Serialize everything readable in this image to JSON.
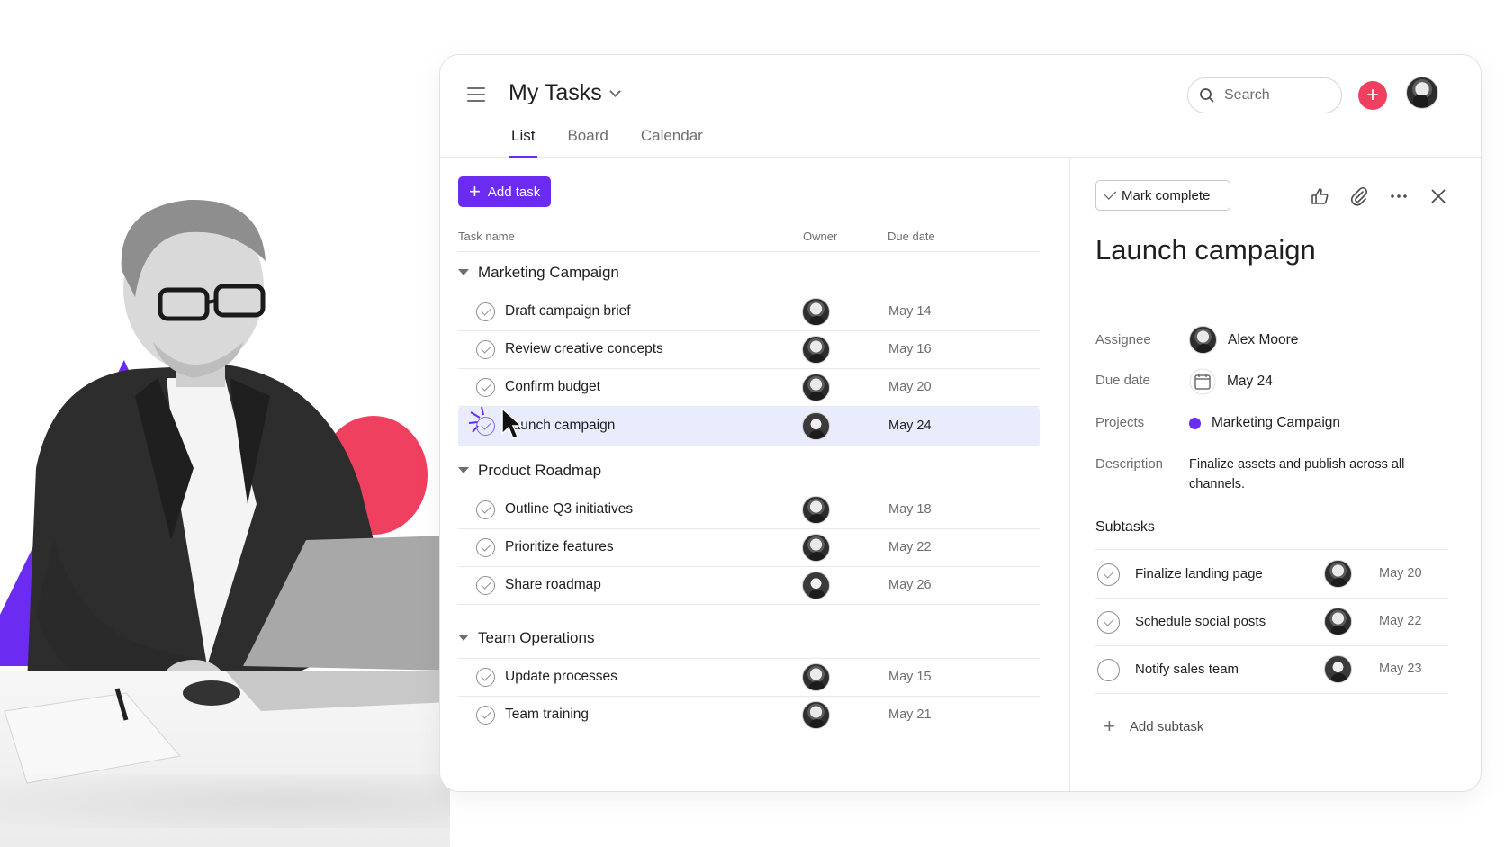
{
  "header": {
    "title": "My Tasks",
    "tabs": [
      "List",
      "Board",
      "Calendar"
    ],
    "search_placeholder": "Search",
    "add_symbol": "+"
  },
  "list": {
    "add_task_label": "Add task",
    "columns": {
      "name": "Task name",
      "owner": "Owner",
      "due": "Due date"
    },
    "sections": [
      {
        "title": "Marketing Campaign",
        "tasks": [
          {
            "name": "Draft campaign brief",
            "due": "May 14"
          },
          {
            "name": "Review creative concepts",
            "due": "May 16"
          },
          {
            "name": "Confirm budget",
            "due": "May 20"
          },
          {
            "name": "Launch campaign",
            "due": "May 24"
          }
        ]
      },
      {
        "title": "Product Roadmap",
        "tasks": [
          {
            "name": "Outline Q3 initiatives",
            "due": "May 18"
          },
          {
            "name": "Prioritize features",
            "due": "May 22"
          },
          {
            "name": "Share roadmap",
            "due": "May 26"
          }
        ]
      },
      {
        "title": "Team Operations",
        "tasks": [
          {
            "name": "Update processes",
            "due": "May 15"
          },
          {
            "name": "Team training",
            "due": "May 21"
          }
        ]
      }
    ]
  },
  "detail": {
    "mark_complete_label": "Mark complete",
    "title": "Launch campaign",
    "assignee_label": "Assignee",
    "assignee": "Alex Moore",
    "due_label": "Due date",
    "due": "May 24",
    "projects_label": "Projects",
    "project": "Marketing Campaign",
    "description_label": "Description",
    "description": "Finalize assets and publish across all channels.",
    "subtasks_label": "Subtasks",
    "subtasks": [
      {
        "name": "Finalize landing page",
        "due": "May 20",
        "done": true
      },
      {
        "name": "Schedule social posts",
        "due": "May 22",
        "done": true
      },
      {
        "name": "Notify sales team",
        "due": "May 23",
        "done": false
      }
    ],
    "add_subtask_label": "Add subtask"
  },
  "colors": {
    "accent": "#6b2bf0",
    "red": "#f0405f",
    "selected_row": "#e8ecfd"
  }
}
